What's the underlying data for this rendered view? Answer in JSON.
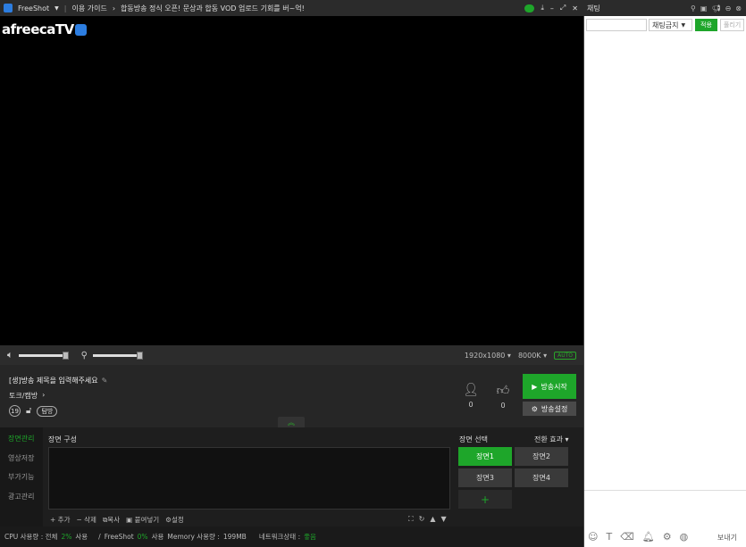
{
  "titlebar": {
    "app_name": "FreeShot",
    "guide": "이용 가이드",
    "notice": "합동방송 정식 오픈! 문상과 합동 VOD 업로드 기회를 버~억!"
  },
  "logo": {
    "text": "afreecaTV"
  },
  "controls": {
    "resolution": "1920x1080",
    "bitrate": "8000K",
    "auto": "AUTO"
  },
  "broadcast": {
    "title_placeholder": "[생]방송 제목을 입력해주세요",
    "category": "토크/캠방",
    "age_badge": "19",
    "tag": "탐방",
    "viewer_count": "0",
    "like_count": "0",
    "start_button": "방송시작",
    "settings_button": "방송설정"
  },
  "scene": {
    "side_tabs": [
      "장면관리",
      "영상저장",
      "부가기능",
      "광고관리"
    ],
    "compose_label": "장면 구성",
    "actions": [
      "+ 추가",
      "− 삭제",
      "복사",
      "붙여넣기",
      "설정"
    ],
    "select_label": "장면 선택",
    "transition_label": "전환 효과",
    "scenes": [
      "장면1",
      "장면2",
      "장면3",
      "장면4"
    ],
    "add_scene": "+"
  },
  "status": {
    "cpu_label": "CPU 사용량 : 전체",
    "cpu_total": "2%",
    "use": "사용",
    "freeshot_label": "FreeShot",
    "freeshot_cpu": "0%",
    "memory_label": "Memory 사용량 :",
    "memory_value": "199MB",
    "network_label": "네트워크상태 :",
    "network_value": "좋음"
  },
  "chat": {
    "title": "채팅",
    "ban_label": "채팅금지",
    "apply": "적용",
    "release": "풀리기",
    "send": "보내기"
  },
  "colors": {
    "accent_green": "#1ea62a",
    "logo_blue": "#2c7de0"
  }
}
